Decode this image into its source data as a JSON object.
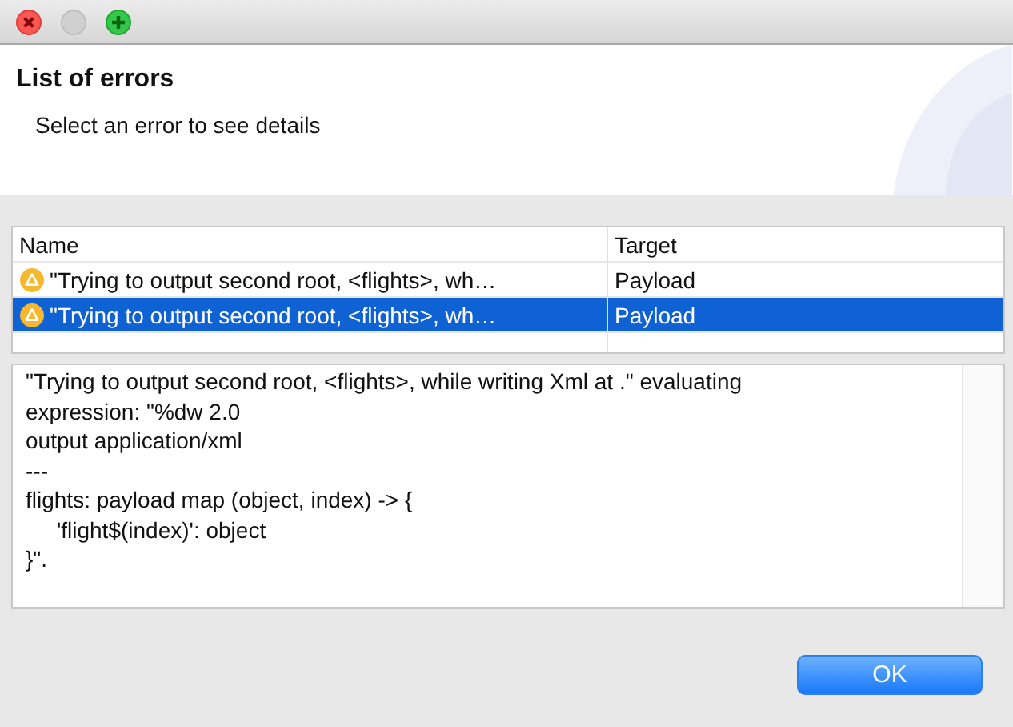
{
  "header": {
    "title": "List of errors",
    "subtitle": "Select an error to see details"
  },
  "table": {
    "columns": [
      "Name",
      "Target"
    ],
    "rows": [
      {
        "name": "\"Trying to output second root, <flights>, wh…",
        "target": "Payload",
        "selected": false
      },
      {
        "name": "\"Trying to output second root, <flights>, wh…",
        "target": "Payload",
        "selected": true
      }
    ]
  },
  "details": "\"Trying to output second root, <flights>, while writing Xml at .\" evaluating\nexpression: \"%dw 2.0\noutput application/xml\n---\nflights: payload map (object, index) -> {\n\t'flight$(index)': object\n}\".",
  "buttons": [
    "OK"
  ]
}
